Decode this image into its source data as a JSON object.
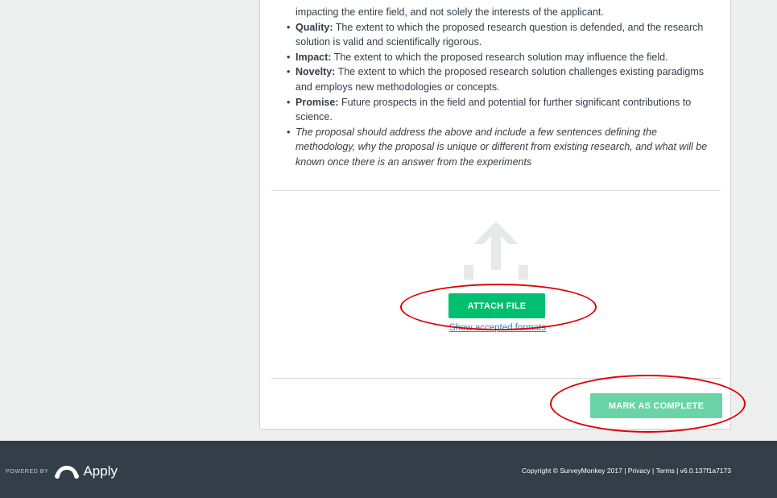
{
  "criteria": {
    "line0": "impacting the entire field, and not solely the interests of the applicant.",
    "items": [
      {
        "term": "Quality:",
        "text": " The extent to which the proposed research question is defended, and the research solution is valid and scientifically rigorous."
      },
      {
        "term": "Impact:",
        "text": " The extent to which the proposed research solution may influence the field."
      },
      {
        "term": "Novelty:",
        "text": " The extent to which the proposed research solution challenges existing paradigms and employs new methodologies or concepts."
      },
      {
        "term": "Promise:",
        "text": " Future prospects in the field and potential for further significant contributions to science."
      }
    ],
    "note": "The proposal should address the above and include a few sentences defining the methodology, why the proposal is unique or different from existing research, and what will be known once there is an answer from the experiments"
  },
  "upload": {
    "icon": "upload-arrow-icon",
    "attach_label": "ATTACH FILE",
    "formats_link": "Show accepted formats"
  },
  "actions": {
    "mark_complete_label": "MARK AS COMPLETE"
  },
  "footer": {
    "powered_by": "POWERED BY",
    "brand": "Apply",
    "tm": "·",
    "copyright": "Copyright © SurveyMonkey 2017",
    "sep": " | ",
    "privacy": "Privacy",
    "terms": "Terms",
    "version": "v6.0.137f1a7173"
  },
  "colors": {
    "accent": "#00bf6f",
    "accent_disabled": "#6ad4a6",
    "footer_bg": "#333e48",
    "annotation": "#e00000"
  }
}
